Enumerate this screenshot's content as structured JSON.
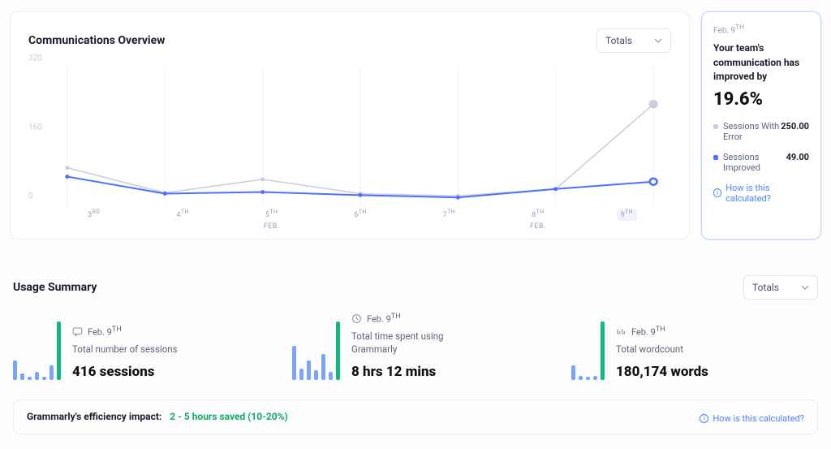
{
  "overview": {
    "title": "Communications Overview",
    "selector": "Totals"
  },
  "chart_data": {
    "type": "line",
    "x_labels": [
      {
        "day": "3",
        "ord": "RD",
        "month": ""
      },
      {
        "day": "4",
        "ord": "TH",
        "month": ""
      },
      {
        "day": "5",
        "ord": "TH",
        "month": "FEB."
      },
      {
        "day": "6",
        "ord": "TH",
        "month": ""
      },
      {
        "day": "7",
        "ord": "TH",
        "month": ""
      },
      {
        "day": "8",
        "ord": "TH",
        "month": "FEB."
      },
      {
        "day": "9",
        "ord": "TH",
        "month": ""
      }
    ],
    "selected_index": 6,
    "y_ticks": [
      0,
      160,
      320
    ],
    "ylim": [
      0,
      320
    ],
    "series": [
      {
        "name": "Sessions With Error",
        "color": "#c7cfdc",
        "values": [
          85,
          20,
          55,
          18,
          12,
          30,
          250
        ]
      },
      {
        "name": "Sessions Improved",
        "color": "#4f6fff",
        "values": [
          62,
          18,
          22,
          14,
          8,
          30,
          49
        ]
      }
    ]
  },
  "sidebar": {
    "date_day": "Feb. 9",
    "date_ord": "TH",
    "headline_line1": "Your team's",
    "headline_line2": "communication has",
    "headline_line3": "improved by",
    "percent": "19.6%",
    "rows": [
      {
        "color": "#c7cfdc",
        "label": "Sessions With Error",
        "value": "250.00"
      },
      {
        "color": "#4f6fff",
        "label": "Sessions Improved",
        "value": "49.00"
      }
    ],
    "calc_link": "How is this calculated?"
  },
  "usage": {
    "title": "Usage Summary",
    "selector": "Totals",
    "items": [
      {
        "icon": "chat",
        "date_day": "Feb. 9",
        "date_ord": "TH",
        "label": "Total number of sessions",
        "value": "416 sessions",
        "spark": [
          {
            "h": 24,
            "c": "#7aa3ff"
          },
          {
            "h": 8,
            "c": "#7aa3ff"
          },
          {
            "h": 4,
            "c": "#7aa3ff"
          },
          {
            "h": 10,
            "c": "#7aa3ff"
          },
          {
            "h": 4,
            "c": "#7aa3ff"
          },
          {
            "h": 18,
            "c": "#7aa3ff"
          },
          {
            "h": 72,
            "c": "#10b981"
          }
        ]
      },
      {
        "icon": "clock",
        "date_day": "Feb. 9",
        "date_ord": "TH",
        "label": "Total time spent using Grammarly",
        "value": "8 hrs 12 mins",
        "spark": [
          {
            "h": 42,
            "c": "#7aa3ff"
          },
          {
            "h": 14,
            "c": "#7aa3ff"
          },
          {
            "h": 24,
            "c": "#7aa3ff"
          },
          {
            "h": 12,
            "c": "#7aa3ff"
          },
          {
            "h": 32,
            "c": "#7aa3ff"
          },
          {
            "h": 10,
            "c": "#7aa3ff"
          },
          {
            "h": 72,
            "c": "#10b981"
          }
        ]
      },
      {
        "icon": "quote",
        "date_day": "Feb. 9",
        "date_ord": "TH",
        "label": "Total wordcount",
        "value": "180,174 words",
        "spark": [
          {
            "h": 18,
            "c": "#7aa3ff"
          },
          {
            "h": 5,
            "c": "#7aa3ff"
          },
          {
            "h": 4,
            "c": "#7aa3ff"
          },
          {
            "h": 5,
            "c": "#7aa3ff"
          },
          {
            "h": 72,
            "c": "#10b981"
          }
        ]
      }
    ]
  },
  "impact": {
    "label": "Grammarly's efficiency impact:",
    "value": "2 - 5 hours saved (10-20%)",
    "calc_link": "How is this calculated?"
  }
}
